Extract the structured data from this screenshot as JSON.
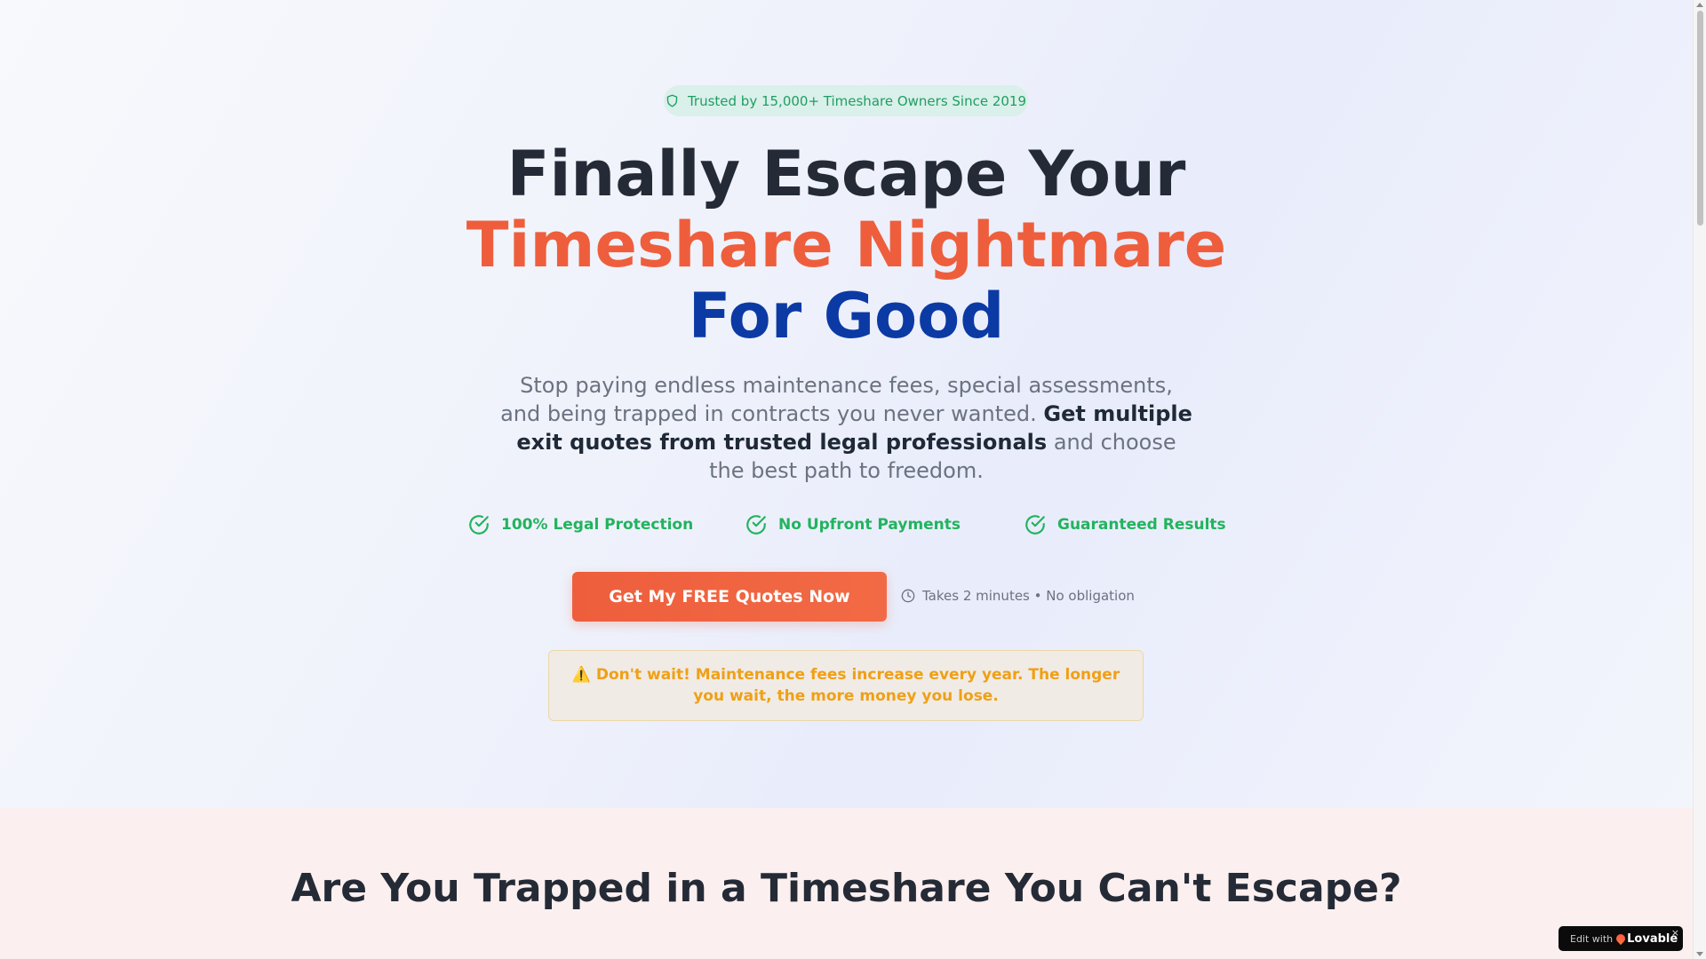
{
  "hero": {
    "badge": "Trusted by 15,000+ Timeshare Owners Since 2019",
    "headline_line1": "Finally Escape Your",
    "headline_line2": "Timeshare Nightmare",
    "headline_line3": "For Good",
    "lede_part1": "Stop paying endless maintenance fees, special assessments, and being trapped in contracts you never wanted.",
    "lede_bold": "Get multiple exit quotes from trusted legal professionals",
    "lede_part2": "and choose the best path to freedom.",
    "features": [
      {
        "label": "100% Legal Protection",
        "icon": "check-circle-icon"
      },
      {
        "label": "No Upfront Payments",
        "icon": "check-circle-icon"
      },
      {
        "label": "Guaranteed Results",
        "icon": "check-circle-icon"
      }
    ],
    "cta_label": "Get My FREE Quotes Now",
    "cta_note": "Takes 2 minutes • No obligation",
    "warning": "⚠️ Don't wait! Maintenance fees increase every year. The longer you wait, the more money you lose."
  },
  "section2": {
    "title": "Are You Trapped in a Timeshare You Can't Escape?"
  },
  "lovable_badge": {
    "prefix": "Edit with",
    "brand": "Lovable",
    "close": "×"
  },
  "colors": {
    "accent_orange": "#ee5e3c",
    "accent_blue": "#0b3aa5",
    "success_green": "#22b35e",
    "warning_amber": "#efa016"
  }
}
